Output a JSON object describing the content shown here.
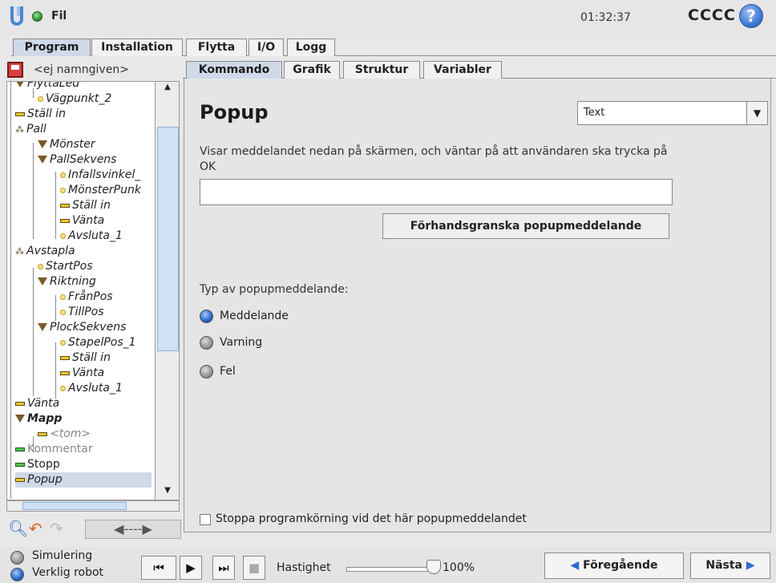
{
  "header": {
    "file_menu": "Fil",
    "clock": "01:32:37",
    "robot_name": "CCCC",
    "help": "?"
  },
  "main_tabs": [
    "Program",
    "Installation",
    "Flytta",
    "I/O",
    "Logg"
  ],
  "program": {
    "name": "<ej namngiven>"
  },
  "tree": [
    {
      "label": "FlyttaLed",
      "icon": "move-triangle"
    },
    {
      "label": "Vägpunkt_2",
      "icon": "waypoint-dot"
    },
    {
      "label": "Ställ in",
      "icon": "set-dash"
    },
    {
      "label": "Pall",
      "icon": "pallet-icon"
    },
    {
      "label": "Mönster",
      "icon": "move-triangle"
    },
    {
      "label": "PallSekvens",
      "icon": "move-triangle"
    },
    {
      "label": "Infallsvinkel_",
      "icon": "waypoint-dot"
    },
    {
      "label": "MönsterPunk",
      "icon": "waypoint-dot"
    },
    {
      "label": "Ställ in",
      "icon": "set-dash"
    },
    {
      "label": "Vänta",
      "icon": "set-dash"
    },
    {
      "label": "Avsluta_1",
      "icon": "waypoint-dot"
    },
    {
      "label": "Avstapla",
      "icon": "pallet-icon"
    },
    {
      "label": "StartPos",
      "icon": "waypoint-dot"
    },
    {
      "label": "Riktning",
      "icon": "move-triangle"
    },
    {
      "label": "FrånPos",
      "icon": "waypoint-dot"
    },
    {
      "label": "TillPos",
      "icon": "waypoint-dot"
    },
    {
      "label": "PlockSekvens",
      "icon": "move-triangle"
    },
    {
      "label": "StapelPos_1",
      "icon": "waypoint-dot"
    },
    {
      "label": "Ställ in",
      "icon": "set-dash"
    },
    {
      "label": "Vänta",
      "icon": "set-dash"
    },
    {
      "label": "Avsluta_1",
      "icon": "waypoint-dot"
    },
    {
      "label": "Vänta",
      "icon": "set-dash"
    },
    {
      "label": "Mapp",
      "icon": "move-triangle"
    },
    {
      "label": "<tom>",
      "icon": "set-dash"
    },
    {
      "label": "Kommentar",
      "icon": "comment-dash"
    },
    {
      "label": "Stopp",
      "icon": "stop-dash"
    },
    {
      "label": "Popup",
      "icon": "set-dash"
    }
  ],
  "tree_tools": {
    "move_label": "◀----▶"
  },
  "sub_tabs": [
    "Kommando",
    "Grafik",
    "Struktur",
    "Variabler"
  ],
  "popup": {
    "title": "Popup",
    "type_select": "Text",
    "description": "Visar meddelandet nedan på skärmen, och väntar på att användaren ska trycka på OK",
    "message_value": "",
    "preview_button": "Förhandsgranska popupmeddelande",
    "type_label": "Typ av popupmeddelande:",
    "options": [
      "Meddelande",
      "Varning",
      "Fel"
    ],
    "selected_option": "Meddelande",
    "stop_checkbox_label": "Stoppa programkörning vid det här popupmeddelandet",
    "stop_checked": false
  },
  "footer": {
    "simulation": "Simulering",
    "real_robot": "Verklig robot",
    "speed_label": "Hastighet",
    "speed_value": "100%",
    "speed_fraction": 1.0,
    "prev_button": "Föregående",
    "next_button": "Nästa"
  },
  "colors": {
    "accent_blue": "#2b6bd1",
    "tab_active": "#cfd9e8",
    "status_green": "#2c9a2c"
  }
}
